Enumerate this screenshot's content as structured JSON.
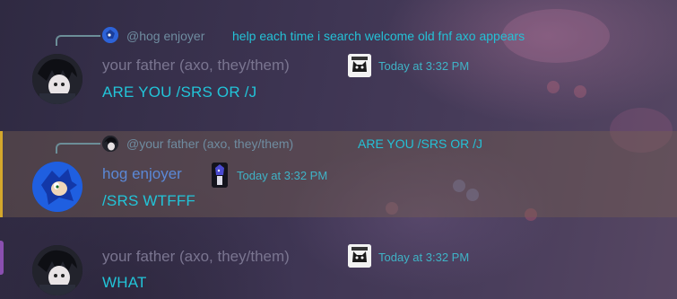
{
  "messages": [
    {
      "reply": {
        "author": "@hog enjoyer",
        "text": "help each time i search welcome old fnf axo appears"
      },
      "author": "your father (axo, they/them)",
      "timestamp": "Today at 3:32 PM",
      "content": "ARE YOU /SRS OR /J"
    },
    {
      "reply": {
        "author": "@your father (axo, they/them)",
        "text": "ARE YOU /SRS OR /J"
      },
      "author": "hog enjoyer",
      "timestamp": "Today at 3:32 PM",
      "content": "/SRS WTFFF"
    },
    {
      "author": "your father (axo, they/them)",
      "timestamp": "Today at 3:32 PM",
      "content": "WHAT"
    }
  ],
  "colors": {
    "mention_highlight": "#d4a72c",
    "message_text": "#22c4d8",
    "timestamp": "#3fb3c6"
  },
  "icons": {
    "avatar_axo": "dark-anime-avatar",
    "avatar_hog": "blue-hedgehog-avatar",
    "role_badge": "cat-icon"
  }
}
